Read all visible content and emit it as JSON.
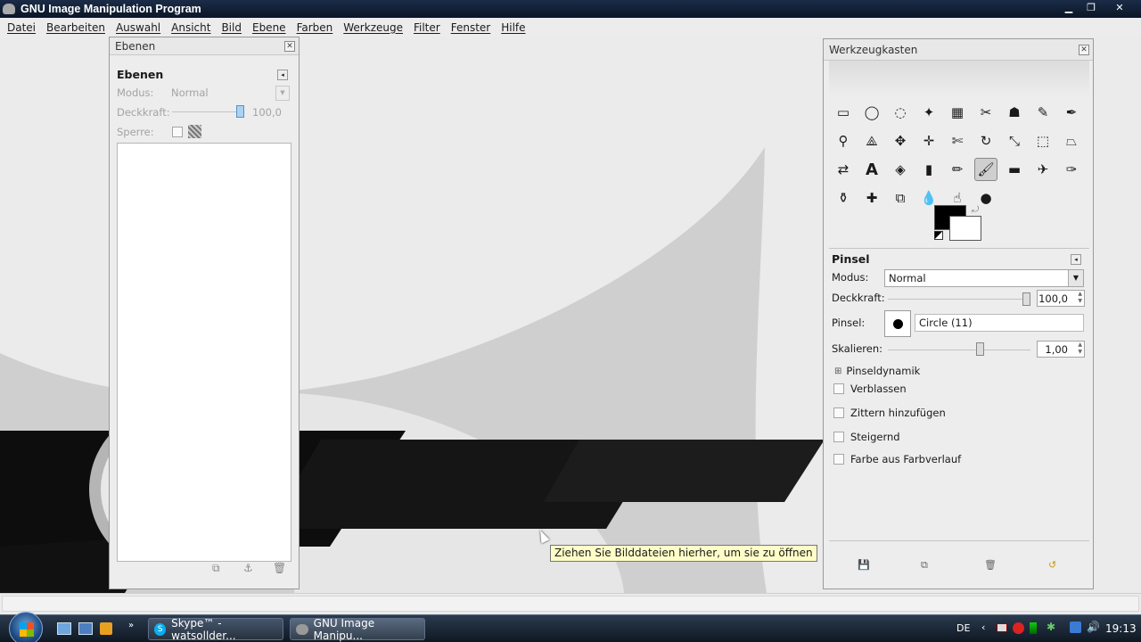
{
  "window": {
    "title": "GNU Image Manipulation Program"
  },
  "menu": [
    "Datei",
    "Bearbeiten",
    "Auswahl",
    "Ansicht",
    "Bild",
    "Ebene",
    "Farben",
    "Werkzeuge",
    "Filter",
    "Fenster",
    "Hilfe"
  ],
  "layers_panel": {
    "window_title": "Ebenen",
    "heading": "Ebenen",
    "mode_label": "Modus:",
    "mode_value": "Normal",
    "opacity_label": "Deckkraft:",
    "opacity_value": "100,0",
    "lock_label": "Sperre:"
  },
  "toolbox": {
    "window_title": "Werkzeugkasten",
    "tools": [
      [
        "rect-select-icon",
        "ellipse-select-icon",
        "free-select-icon",
        "fuzzy-select-icon",
        "color-select-icon",
        "scissors-select-icon",
        "foreground-select-icon",
        "paths-icon",
        "color-picker-icon"
      ],
      [
        "zoom-icon",
        "measure-icon",
        "move-icon",
        "align-icon",
        "crop-icon",
        "rotate-icon",
        "scale-icon",
        "shear-icon",
        "perspective-icon"
      ],
      [
        "flip-icon",
        "text-icon",
        "bucket-fill-icon",
        "blend-icon",
        "pencil-icon",
        "paintbrush-icon",
        "eraser-icon",
        "airbrush-icon",
        "ink-icon"
      ],
      [
        "clone-icon",
        "heal-icon",
        "perspective-clone-icon",
        "blur-icon",
        "smudge-icon",
        "dodge-burn-icon"
      ]
    ],
    "tool_glyphs": {
      "rect-select-icon": "▭",
      "ellipse-select-icon": "◯",
      "free-select-icon": "◌",
      "fuzzy-select-icon": "✦",
      "color-select-icon": "▦",
      "scissors-select-icon": "✂",
      "foreground-select-icon": "☗",
      "paths-icon": "✎",
      "color-picker-icon": "✒",
      "zoom-icon": "⚲",
      "measure-icon": "⟁",
      "move-icon": "✥",
      "align-icon": "✛",
      "crop-icon": "✄",
      "rotate-icon": "↻",
      "scale-icon": "⤡",
      "shear-icon": "⬚",
      "perspective-icon": "⏢",
      "flip-icon": "⇄",
      "text-icon": "A",
      "bucket-fill-icon": "◈",
      "blend-icon": "▮",
      "pencil-icon": "✏",
      "paintbrush-icon": "🖌",
      "eraser-icon": "▬",
      "airbrush-icon": "✈",
      "ink-icon": "✑",
      "clone-icon": "⚱",
      "heal-icon": "✚",
      "perspective-clone-icon": "⧉",
      "blur-icon": "💧",
      "smudge-icon": "☝",
      "dodge-burn-icon": "●"
    },
    "fg_color": "#000000",
    "bg_color": "#ffffff"
  },
  "tool_options": {
    "heading": "Pinsel",
    "mode_label": "Modus:",
    "mode_value": "Normal",
    "opacity_label": "Deckkraft:",
    "opacity_value": "100,0",
    "brush_label": "Pinsel:",
    "brush_value": "Circle (11)",
    "scale_label": "Skalieren:",
    "scale_value": "1,00",
    "dynamics_label": "Pinseldynamik",
    "options": [
      "Verblassen",
      "Zittern hinzufügen",
      "Steigernd",
      "Farbe aus Farbverlauf"
    ]
  },
  "tooltip": "Ziehen Sie Bilddateien hierher, um sie zu öffnen",
  "taskbar": {
    "tasks": [
      "Skype™ - watsollder...",
      "GNU Image Manipu..."
    ],
    "language": "DE",
    "clock": "19:13"
  }
}
